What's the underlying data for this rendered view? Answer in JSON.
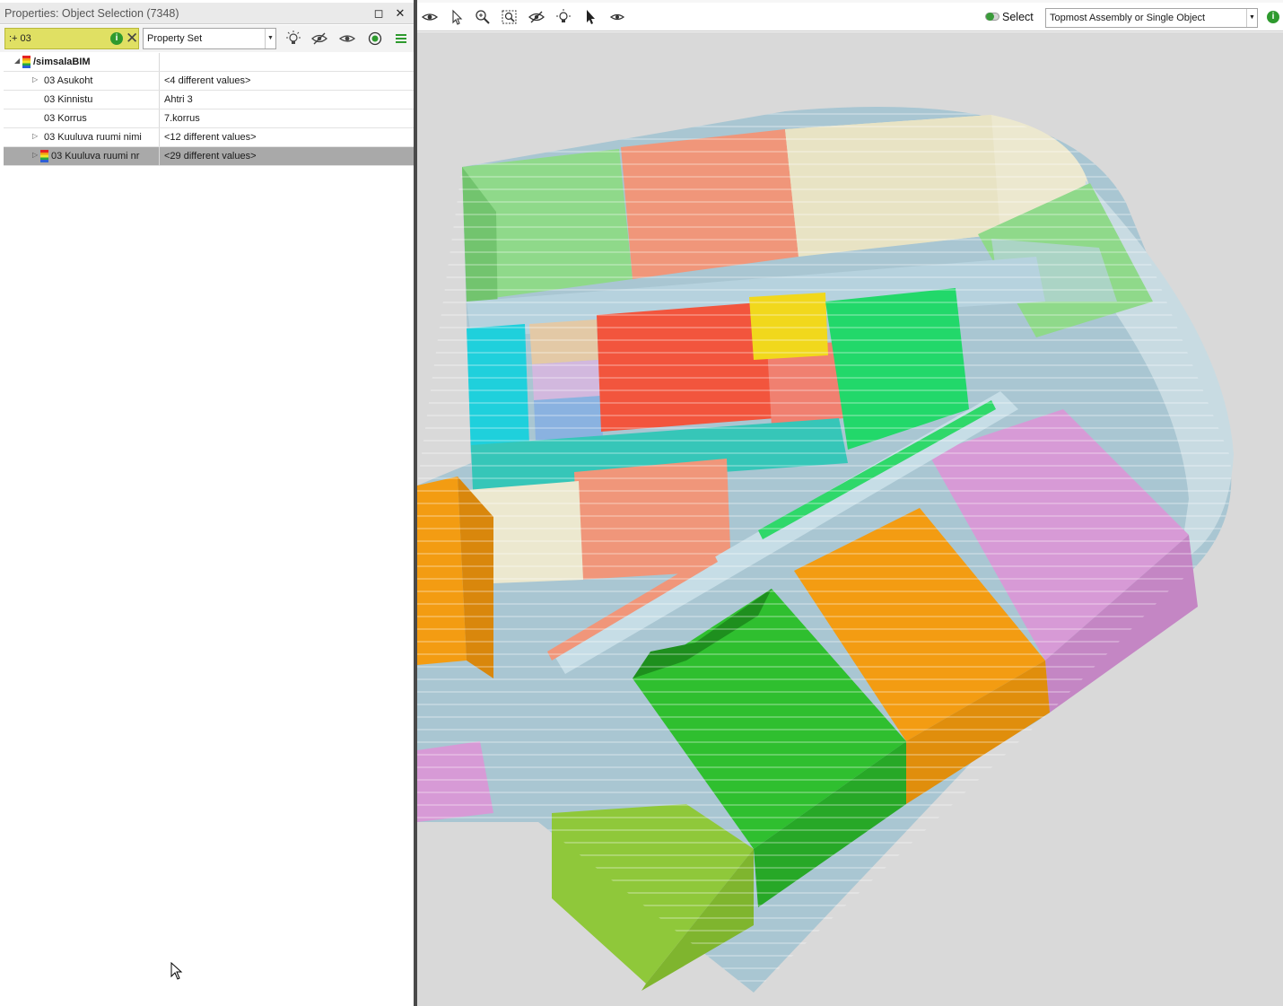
{
  "panel": {
    "title": "Properties: Object Selection (7348)",
    "maximize_icon": "maximize-icon",
    "close_icon": "close-icon"
  },
  "filter": {
    "value": ":+ 03",
    "info_glyph": "i"
  },
  "property_set": {
    "selected": "Property Set"
  },
  "tree": {
    "root_label": "/simsalaBIM",
    "rows": [
      {
        "label": "03 Asukoht",
        "value": "<4 different values>"
      },
      {
        "label": "03 Kinnistu",
        "value": "Ahtri 3"
      },
      {
        "label": "03 Korrus",
        "value": "7.korrus"
      },
      {
        "label": "03 Kuuluva ruumi nimi",
        "value": "<12 different values>"
      },
      {
        "label": "03 Kuuluva ruumi nr",
        "value": "<29 different values>"
      }
    ]
  },
  "viewport_toolbar": {
    "select_label": "Select",
    "mode_selected": "Topmost Assembly or Single Object",
    "info_glyph": "i"
  },
  "colors": {
    "background": "#d9d9d9",
    "light_green": "#8fd98a",
    "salmon": "#f0967a",
    "cream": "#ece8cf",
    "cyan": "#1fd0dc",
    "red": "#f2553d",
    "yellow": "#f1d81c",
    "bright_green": "#22d86a",
    "teal": "#36c6b8",
    "pipe_blue": "#a8c8d8",
    "pink": "#d79ad6",
    "orange": "#f39c12",
    "green": "#2fbf2f",
    "lime": "#8fc83a",
    "filter_yellow": "#e0e063"
  }
}
